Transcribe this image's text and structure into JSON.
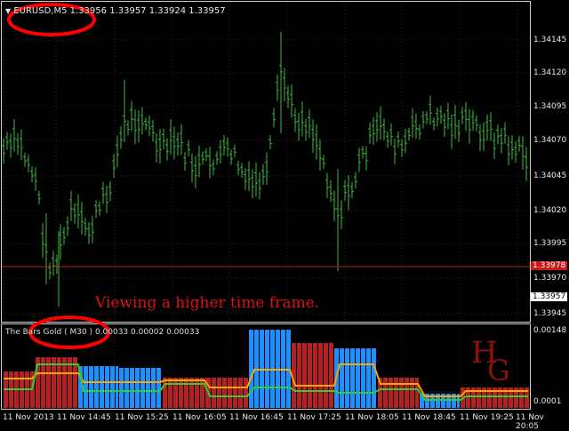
{
  "main_header": {
    "menu_glyph": "▼",
    "symbol_period": "EURUSD,M5",
    "ohlc": "1.33956 1.33957 1.33924 1.33957"
  },
  "annotation_text": "Viewing a higher time frame.",
  "indicator_header": {
    "name_period": "The Bars Gold ( M30 )",
    "values": "0.00033 0.00002 0.00033"
  },
  "logo_text": "HG",
  "price_axis": [
    "1.34145",
    "1.34120",
    "1.34095",
    "1.34070",
    "1.34045",
    "1.34020",
    "1.33995",
    "1.33978",
    "1.33970",
    "1.33957",
    "1.33945"
  ],
  "current_price_label": "1.33978",
  "indicator_axis": [
    "0.00148",
    "0.0001"
  ],
  "time_axis": [
    "11 Nov 2013",
    "11 Nov 14:45",
    "11 Nov 15:25",
    "11 Nov 16:05",
    "11 Nov 16:45",
    "11 Nov 17:25",
    "11 Nov 18:05",
    "11 Nov 18:45",
    "11 Nov 19:25",
    "11 Nov 20:05"
  ],
  "colors": {
    "background": "#000000",
    "grid": "#2a2a2a",
    "bars": "#3dbb3d",
    "level_line": "#c81818",
    "annotation": "#d11111",
    "red_block": "#b22222",
    "blue_block": "#1e90ff",
    "yellow_line": "#ffa500",
    "green_line": "#32cd32"
  }
}
